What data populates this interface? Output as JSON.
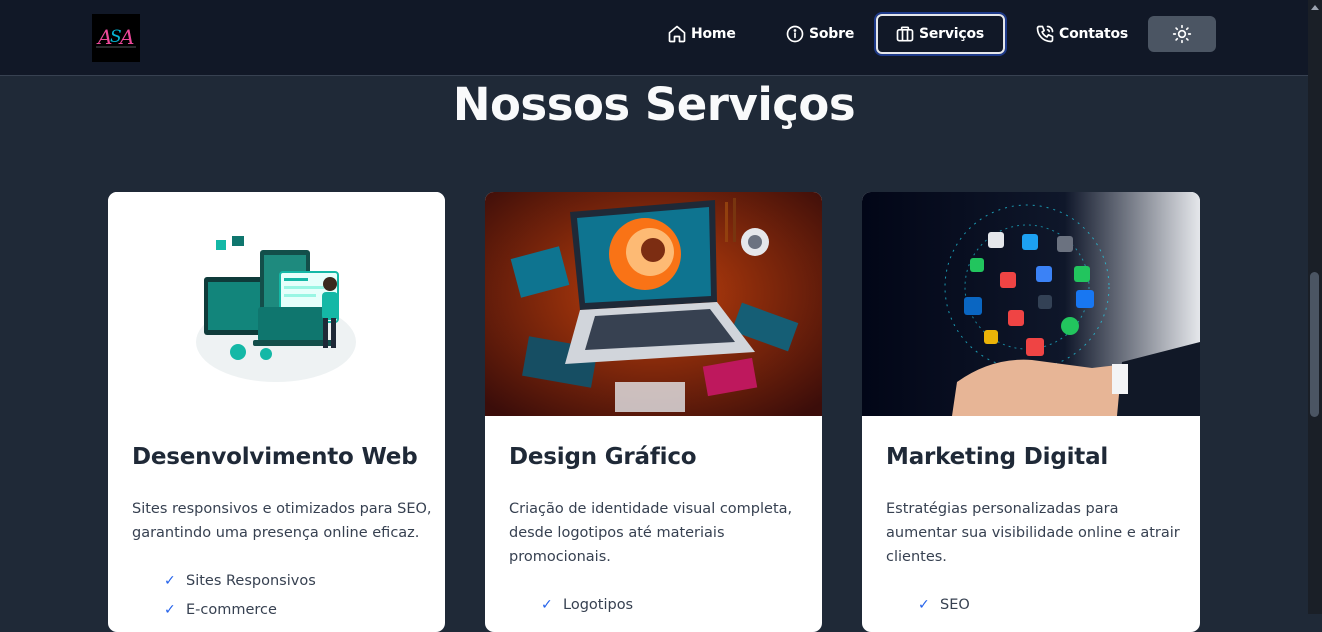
{
  "logo": {
    "text": "ASA"
  },
  "nav": {
    "home": "Home",
    "sobre": "Sobre",
    "servicos": "Serviços",
    "contatos": "Contatos"
  },
  "colors": {
    "header": "#111827",
    "page": "#1f2937",
    "accent": "#2563eb",
    "theme_button": "#4b5563"
  },
  "section": {
    "title": "Nossos Serviços"
  },
  "cards": [
    {
      "title": "Desenvolvimento Web",
      "description": "Sites responsivos e otimizados para SEO, garantindo uma presença online eficaz.",
      "features": [
        "Sites Responsivos",
        "E-commerce"
      ]
    },
    {
      "title": "Design Gráfico",
      "description": "Criação de identidade visual completa, desde logotipos até materiais promocionais.",
      "features": [
        "Logotipos"
      ]
    },
    {
      "title": "Marketing Digital",
      "description": "Estratégias personalizadas para aumentar sua visibilidade online e atrair clientes.",
      "features": [
        "SEO"
      ]
    }
  ]
}
